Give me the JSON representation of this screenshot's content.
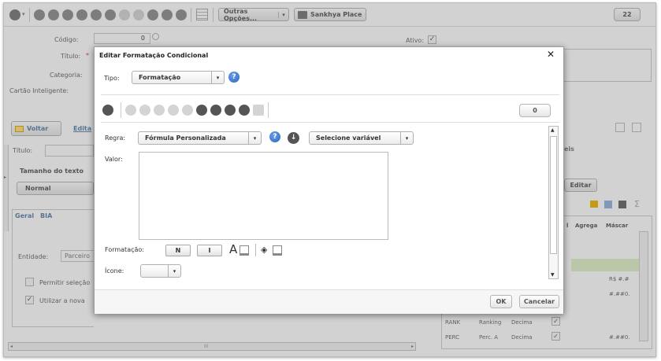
{
  "toolbar": {
    "outras_opcoes": "Outras Opções...",
    "sankhya_place": "Sankhya Place",
    "count": "22"
  },
  "form": {
    "codigo_label": "Código:",
    "codigo_value": "0",
    "titulo_label": "Título:",
    "categoria_label": "Categoria:",
    "cartao_label": "Cartão Inteligente:",
    "ativo_label": "Ativo:",
    "voltar": "Voltar",
    "editar_tab": "Edita",
    "titulo2_label": "Título:",
    "tamanho_label": "Tamanho do texto",
    "normal": "Normal",
    "tabs": [
      "Geral",
      "BIA"
    ],
    "entidade_label": "Entidade:",
    "entidade_value": "Parceiro",
    "permitir": "Permitir seleção",
    "utilizar": "Utilizar a nova",
    "right_header": "eis",
    "editar_btn": "Editar"
  },
  "grid": {
    "headers": [
      "l",
      "Agrega",
      "Máscar"
    ],
    "rows": [
      [
        "",
        "",
        "",
        "",
        "R$ #.#"
      ],
      [
        "",
        "",
        "",
        "",
        "#.##0."
      ],
      [
        "RANK",
        "Ranking",
        "Decima",
        "✓",
        ""
      ],
      [
        "PERC",
        "Perc. A",
        "Decima",
        "✓",
        "#.##0."
      ]
    ]
  },
  "scrollbar_label": "III",
  "dialog": {
    "title": "Editar Formatação Condicional",
    "tipo_label": "Tipo:",
    "tipo_value": "Formatação",
    "count": "0",
    "regra_label": "Regra:",
    "regra_value": "Fórmula Personalizada",
    "variavel_value": "Selecione variável",
    "valor_label": "Valor:",
    "formatacao_label": "Formatação:",
    "bold": "N",
    "italic": "I",
    "font_a": "A",
    "icone_label": "Ícone:",
    "ok": "OK",
    "cancelar": "Cancelar"
  }
}
